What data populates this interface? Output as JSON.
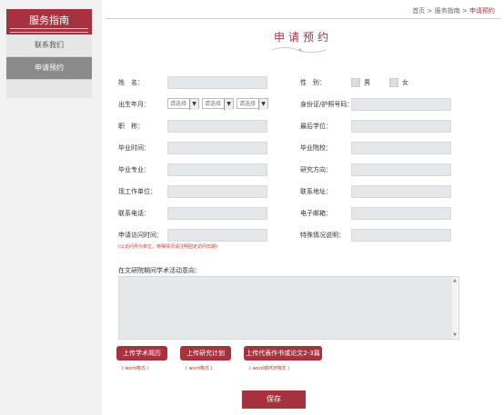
{
  "sidebar": {
    "title": "服务指南",
    "items": [
      {
        "label": "联系我们"
      },
      {
        "label": "申请预约"
      }
    ]
  },
  "breadcrumb": {
    "home": "首页",
    "sep1": ">",
    "section": "服务指南",
    "sep2": ">",
    "current": "申请预约"
  },
  "form": {
    "title": "申请预约",
    "name_label": "姓　名：",
    "gender_label": "性　别：",
    "male": "男",
    "female": "女",
    "birth_label": "出生年月：",
    "select_placeholder": "请选择",
    "id_label": "身份证/护照号码：",
    "title_rank_label": "职　称：",
    "degree_label": "最后学位：",
    "grad_time_label": "毕业时间：",
    "school_label": "毕业院校：",
    "major_label": "毕业专业：",
    "research_label": "研究方向：",
    "employer_label": "现工作单位：",
    "address_label": "联系地址：",
    "phone_label": "联系电话：",
    "email_label": "电子邮箱：",
    "visit_time_label": "申请访问时间：",
    "special_label": "特殊情况说明：",
    "visit_note": "(以访问月为单位，特殊情况请注明固定访问日期)",
    "intent_label": "在文研院期间学术活动意向：",
    "upload_cv": "上传学术简历",
    "upload_plan": "上传研究计划",
    "upload_works": "上传代表作书或论文2-3篇",
    "word_format": "( word格式 )",
    "pdf_format": "( word或PDF格式 )",
    "save": "保存"
  },
  "colors": {
    "accent": "#a6323e",
    "field": "#e5e8ea"
  }
}
